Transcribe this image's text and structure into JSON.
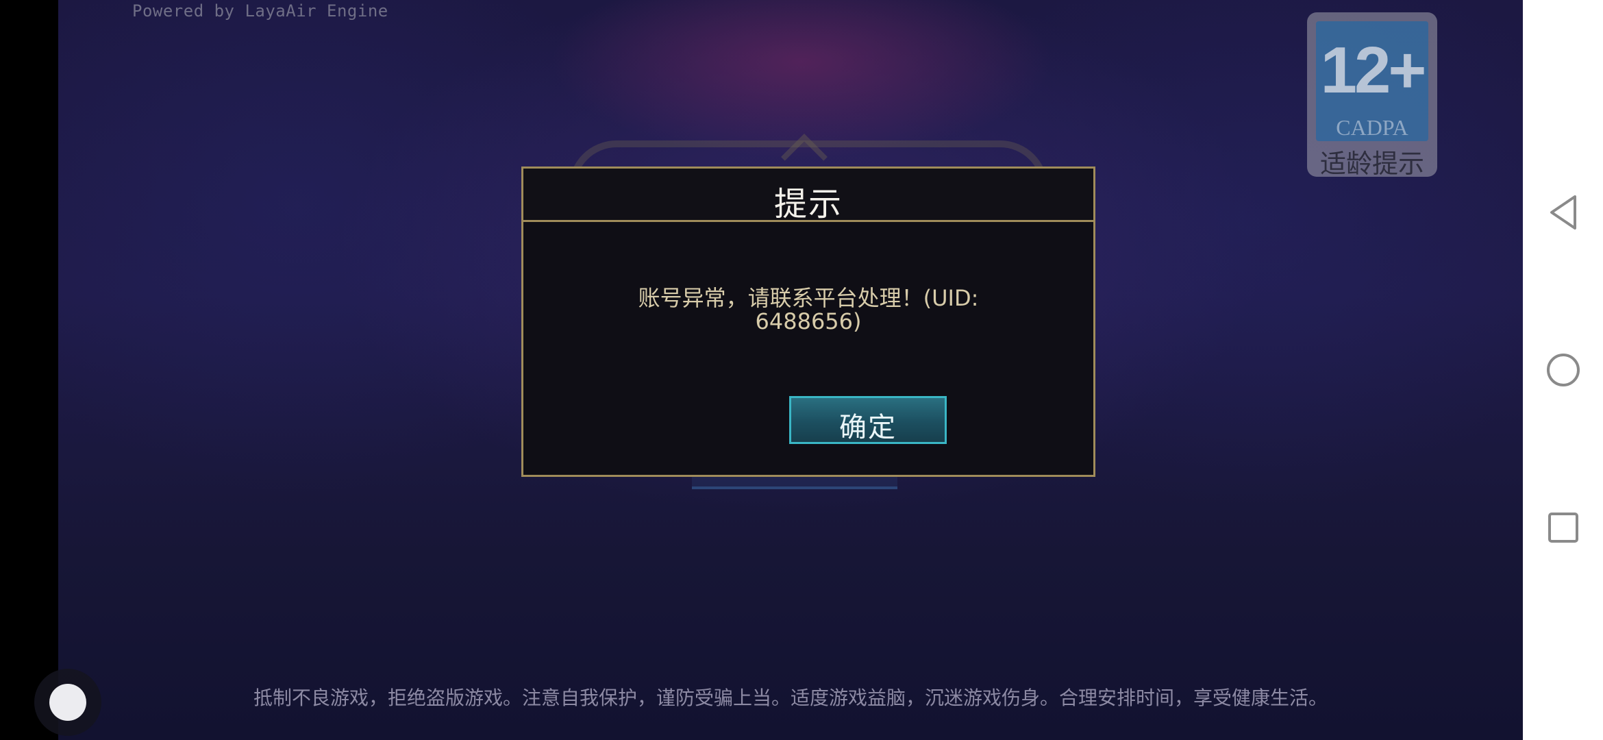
{
  "engine_credit": "Powered by LayaAir Engine",
  "age_rating": {
    "number": "12+",
    "org": "CADPA",
    "label": "适龄提示"
  },
  "dialog": {
    "title": "提示",
    "message_line1": "账号异常，请联系平台处理！(UID:",
    "message_line2": "6488656)",
    "confirm_label": "确定"
  },
  "health_notice": "抵制不良游戏，拒绝盗版游戏。注意自我保护，谨防受骗上当。适度游戏益脑，沉迷游戏伤身。合理安排时间，享受健康生活。",
  "navigation": {
    "back_icon": "triangle-back-icon",
    "home_icon": "circle-home-icon",
    "recents_icon": "square-recents-icon"
  },
  "colors": {
    "dialog_border": "#a08c5a",
    "message_text": "#d8ccaa",
    "button_border": "#3ab6c5",
    "badge_blue": "#1f67a5"
  }
}
